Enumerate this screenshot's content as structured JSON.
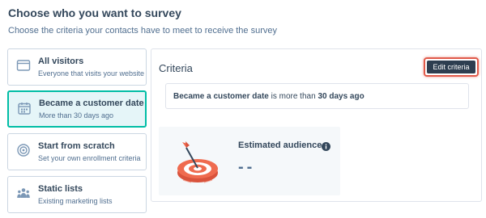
{
  "page": {
    "heading": "Choose who you want to survey",
    "subheading": "Choose the criteria your contacts have to meet to receive the survey"
  },
  "options": [
    {
      "title": "All visitors",
      "description": "Everyone that visits your website",
      "icon": "browser-window-icon",
      "selected": false
    },
    {
      "title": "Became a customer date",
      "description": "More than 30 days ago",
      "icon": "calendar-icon",
      "selected": true
    },
    {
      "title": "Start from scratch",
      "description": "Set your own enrollment criteria",
      "icon": "target-circle-icon",
      "selected": false
    },
    {
      "title": "Static lists",
      "description": "Existing marketing lists",
      "icon": "people-group-icon",
      "selected": false
    }
  ],
  "criteria_panel": {
    "title": "Criteria",
    "edit_button": "Edit criteria",
    "criteria": {
      "property": "Became a customer date",
      "operator": " is more than ",
      "value": "30 days ago"
    }
  },
  "audience": {
    "title": "Estimated audience",
    "value": "--",
    "illustration": "target-dart-illustration",
    "info_icon": "info-icon"
  },
  "colors": {
    "accent_teal": "#00bda5",
    "selected_bg": "#e5f5f8",
    "button_dark": "#2d3e50",
    "highlight_red": "#e05a4a",
    "target_orange": "#ef6b4f"
  }
}
